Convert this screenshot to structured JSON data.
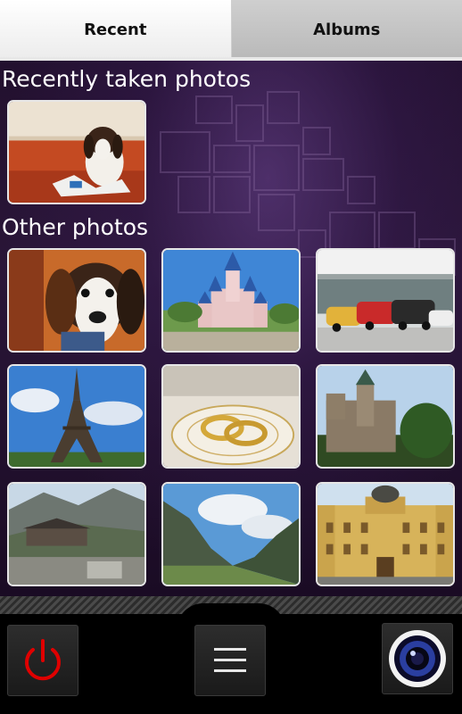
{
  "tabs": [
    {
      "label": "Recent",
      "active": true
    },
    {
      "label": "Albums",
      "active": false
    }
  ],
  "sections": {
    "recent_title": "Recently taken photos",
    "other_title": "Other photos"
  },
  "recent_photos": [
    {
      "subject": "beagle puppy on couch"
    }
  ],
  "other_photos": [
    {
      "subject": "beagle puppy close-up"
    },
    {
      "subject": "fairytale castle"
    },
    {
      "subject": "vintage cars"
    },
    {
      "subject": "eiffel tower"
    },
    {
      "subject": "wedding rings"
    },
    {
      "subject": "hilltop castle"
    },
    {
      "subject": "mountain chalet"
    },
    {
      "subject": "mountain valley"
    },
    {
      "subject": "ornate building"
    }
  ],
  "toolbar": {
    "power_icon": "power-icon",
    "menu_icon": "menu-icon",
    "camera_icon": "camera-lens-icon",
    "accent_red": "#e00000"
  }
}
